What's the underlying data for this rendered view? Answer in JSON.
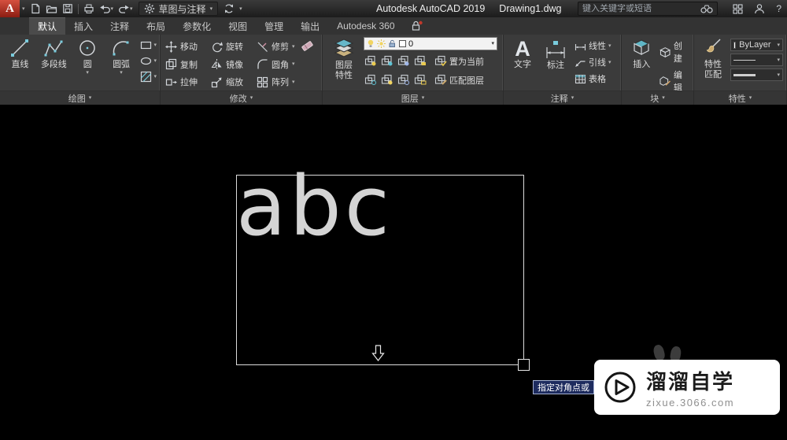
{
  "titlebar": {
    "logo": "A",
    "workspace": "草图与注释",
    "app_title": "Autodesk AutoCAD 2019",
    "doc_title": "Drawing1.dwg",
    "search_placeholder": "键入关键字或短语"
  },
  "tabs": [
    "默认",
    "插入",
    "注释",
    "布局",
    "参数化",
    "视图",
    "管理",
    "输出",
    "Autodesk 360"
  ],
  "panels": {
    "draw": {
      "title": "绘图",
      "items": [
        "直线",
        "多段线",
        "圆",
        "圆弧"
      ]
    },
    "modify": {
      "title": "修改",
      "items": [
        "移动",
        "旋转",
        "修剪",
        "复制",
        "镜像",
        "圆角",
        "拉伸",
        "缩放",
        "阵列"
      ]
    },
    "layers": {
      "title": "图层",
      "main_line1": "图层",
      "main_line2": "特性",
      "current_layer": "0",
      "set_current": "置为当前",
      "match": "匹配图层"
    },
    "annotation": {
      "title": "注释",
      "text": "文字",
      "dimension": "标注",
      "linear": "线性",
      "leader": "引线",
      "table": "表格"
    },
    "block": {
      "title": "块",
      "insert": "插入",
      "create": "创建",
      "edit": "编辑"
    },
    "properties": {
      "title": "特性",
      "match_line1": "特性",
      "match_line2": "匹配",
      "bylayer": "ByLayer"
    }
  },
  "canvas": {
    "text_preview": "abc",
    "tooltip": "指定对角点或"
  },
  "watermark": {
    "name": "溜溜自学",
    "url": "zixue.3066.com"
  }
}
